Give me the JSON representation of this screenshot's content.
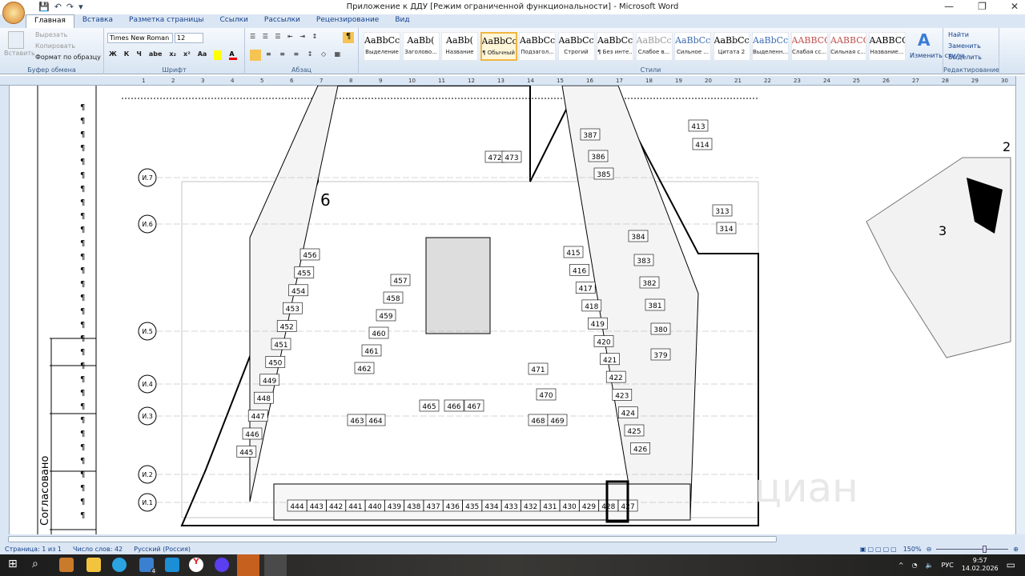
{
  "window": {
    "title": "Приложение к ДДУ [Режим ограниченной функциональности] - Microsoft Word",
    "controls": [
      "—",
      "❐",
      "✕"
    ]
  },
  "qat": [
    "💾",
    "↶",
    "↷",
    "▾"
  ],
  "tabs": [
    "Главная",
    "Вставка",
    "Разметка страницы",
    "Ссылки",
    "Рассылки",
    "Рецензирование",
    "Вид"
  ],
  "clipboard": {
    "paste": "Вставить",
    "cut": "Вырезать",
    "copy": "Копировать",
    "format": "Формат по образцу",
    "label": "Буфер обмена"
  },
  "font": {
    "name": "Times New Roman",
    "size": "12",
    "label": "Шрифт",
    "buttons": [
      "Ж",
      "К",
      "Ч",
      "abe",
      "x₂",
      "x²",
      "Aa"
    ]
  },
  "paragraph": {
    "label": "Абзац"
  },
  "styles": {
    "label": "Стили",
    "items": [
      {
        "sample": "AaBbCcI",
        "name": "Выделение"
      },
      {
        "sample": "AaBb(",
        "name": "Заголово..."
      },
      {
        "sample": "AaBb(",
        "name": "Название"
      },
      {
        "sample": "AaBbCcI",
        "name": "¶ Обычный"
      },
      {
        "sample": "AaBbCcI",
        "name": "Подзагол..."
      },
      {
        "sample": "AaBbCcl",
        "name": "Строгий"
      },
      {
        "sample": "AaBbCcI",
        "name": "¶ Без инте..."
      },
      {
        "sample": "AaBbCcL",
        "name": "Слабое в..."
      },
      {
        "sample": "AaBbCc",
        "name": "Сильное ..."
      },
      {
        "sample": "AaBbCcL",
        "name": "Цитата 2"
      },
      {
        "sample": "AaBbCc",
        "name": "Выделенн..."
      },
      {
        "sample": "AABBCC",
        "name": "Слабая сс..."
      },
      {
        "sample": "AABBCC",
        "name": "Сильная с..."
      },
      {
        "sample": "AABBCC",
        "name": "Название..."
      }
    ],
    "change": "Изменить стили"
  },
  "editing": {
    "label": "Редактирование",
    "find": "Найти",
    "replace": "Заменить",
    "select": "Выделить"
  },
  "document": {
    "margin_text": "Согласовано",
    "section": "6",
    "axes": [
      "И.7",
      "И.6",
      "И.5",
      "И.4",
      "И.3",
      "И.2",
      "И.1"
    ],
    "bottom_row": [
      "444",
      "443",
      "442",
      "441",
      "440",
      "439",
      "438",
      "437",
      "436",
      "435",
      "434",
      "433",
      "432",
      "431",
      "430",
      "429",
      "428",
      "427"
    ],
    "left_diag": [
      "456",
      "455",
      "454",
      "453",
      "452",
      "451",
      "450",
      "449",
      "448",
      "447",
      "446",
      "445"
    ],
    "inner_left": [
      "457",
      "458",
      "459",
      "460",
      "461",
      "462"
    ],
    "center": [
      "463",
      "464",
      "465",
      "466",
      "467",
      "468",
      "469",
      "470",
      "471",
      "472",
      "473"
    ],
    "right_diag": [
      "415",
      "416",
      "417",
      "418",
      "419",
      "420",
      "421",
      "422",
      "423",
      "424",
      "425",
      "426"
    ],
    "right_col": [
      "387",
      "386",
      "385",
      "384",
      "383",
      "382",
      "381",
      "380",
      "379",
      "413",
      "414",
      "313",
      "314"
    ],
    "map_labels": [
      "2",
      "3"
    ],
    "watermark": "циан"
  },
  "status": {
    "page": "Страница: 1 из 1",
    "words": "Число слов: 42",
    "lang": "Русский (Россия)",
    "zoom": "150%"
  },
  "tray": {
    "lang": "РУС",
    "time": "9:57",
    "date": "14.02.2026",
    "badge": "4"
  }
}
